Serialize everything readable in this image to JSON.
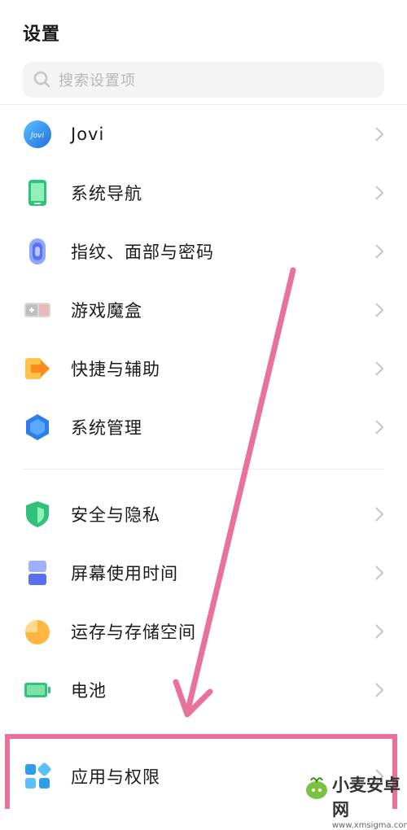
{
  "header": {
    "title": "设置"
  },
  "search": {
    "placeholder": "搜索设置项"
  },
  "menu": [
    {
      "label": "Jovi",
      "icon": "jovi-icon"
    },
    {
      "label": "系统导航",
      "icon": "phone-navigation-icon"
    },
    {
      "label": "指纹、面部与密码",
      "icon": "fingerprint-icon"
    },
    {
      "label": "游戏魔盒",
      "icon": "game-box-icon"
    },
    {
      "label": "快捷与辅助",
      "icon": "shortcut-arrow-icon"
    },
    {
      "label": "系统管理",
      "icon": "hexagon-system-icon"
    },
    {
      "label": "安全与隐私",
      "icon": "shield-icon"
    },
    {
      "label": "屏幕使用时间",
      "icon": "hourglass-icon"
    },
    {
      "label": "运存与存储空间",
      "icon": "pie-storage-icon"
    },
    {
      "label": "电池",
      "icon": "battery-icon"
    },
    {
      "label": "应用与权限",
      "icon": "apps-grid-icon"
    }
  ],
  "watermark": {
    "name": "小麦安卓网",
    "url": "www.xmsigma.com"
  },
  "colors": {
    "highlight": "#e8729a",
    "accent": "#2f9de8"
  }
}
